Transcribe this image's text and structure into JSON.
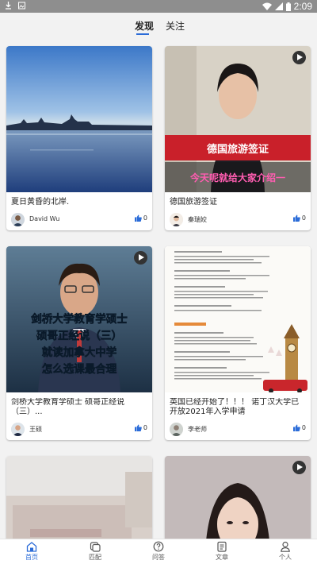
{
  "status_bar": {
    "time": "2:09"
  },
  "tabs": [
    {
      "label": "发现",
      "active": true
    },
    {
      "label": "关注",
      "active": false
    }
  ],
  "posts": [
    {
      "title": "夏日黄昏的北岸.",
      "author": "David Wu",
      "likes": "0",
      "video": false
    },
    {
      "title": "德国旅游签证",
      "author": "秦瑞姣",
      "likes": "0",
      "video": true,
      "caption_main": "德国旅游签证",
      "caption_sub": "今天呢就给大家介绍一"
    },
    {
      "title": "剑桥大学教育学硕士 硕哥正经说（三）...",
      "author": "王硕",
      "likes": "0",
      "video": true,
      "caption_lines": [
        "剑桥大学教育学硕士",
        "硕哥正经说（三）",
        "就读加拿大中学",
        "怎么选课最合理"
      ]
    },
    {
      "title": "英国已经开始了！！！ 诺丁汉大学已开放2021年入学申请",
      "author": "李老师",
      "likes": "0",
      "video": false
    },
    {
      "title": "",
      "author": "",
      "likes": "",
      "video": false
    },
    {
      "title": "",
      "author": "",
      "likes": "",
      "video": true
    }
  ],
  "bottom_nav": [
    {
      "label": "首页",
      "icon": "home-icon",
      "active": true
    },
    {
      "label": "匹配",
      "icon": "match-icon",
      "active": false
    },
    {
      "label": "问答",
      "icon": "question-icon",
      "active": false
    },
    {
      "label": "文章",
      "icon": "article-icon",
      "active": false
    },
    {
      "label": "个人",
      "icon": "person-icon",
      "active": false
    }
  ],
  "colors": {
    "accent": "#2b6cd8",
    "like_icon": "#2b6cd8",
    "status_bar": "#8e8e8e"
  }
}
